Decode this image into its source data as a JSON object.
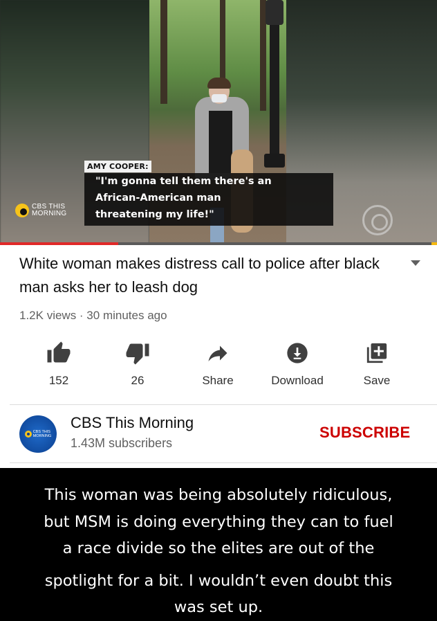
{
  "video": {
    "caption_name": "AMY COOPER:",
    "caption_lines": [
      "\"I'm gonna tell them there's an",
      "African-American man",
      "threatening my life!\""
    ],
    "channel_logo_lines": [
      "CBS THIS",
      "MORNING"
    ],
    "progress_fraction": 0.27,
    "colors": {
      "progress": "#e02828",
      "caption_bg": "#000000",
      "brand_yellow": "#f6c31a"
    }
  },
  "title": "White woman makes distress call to police after black man asks her to leash dog",
  "meta": "1.2K views · 30 minutes ago",
  "actions": [
    {
      "icon": "thumbs-up-icon",
      "label": "152"
    },
    {
      "icon": "thumbs-down-icon",
      "label": "26"
    },
    {
      "icon": "share-icon",
      "label": "Share"
    },
    {
      "icon": "download-icon",
      "label": "Download"
    },
    {
      "icon": "save-icon",
      "label": "Save"
    }
  ],
  "channel": {
    "avatar_lines": [
      "CBS THIS",
      "MORNING"
    ],
    "name": "CBS This Morning",
    "subscribers": "1.43M subscribers",
    "subscribe_label": "SUBSCRIBE",
    "subscribe_color": "#cc0000"
  },
  "comment": {
    "lines": [
      "This woman was being absolutely ridiculous,",
      "but MSM is doing everything they can to fuel",
      "a race divide so the elites are out of the",
      "spotlight for a bit. I wouldn’t even doubt this",
      "was set up."
    ]
  }
}
